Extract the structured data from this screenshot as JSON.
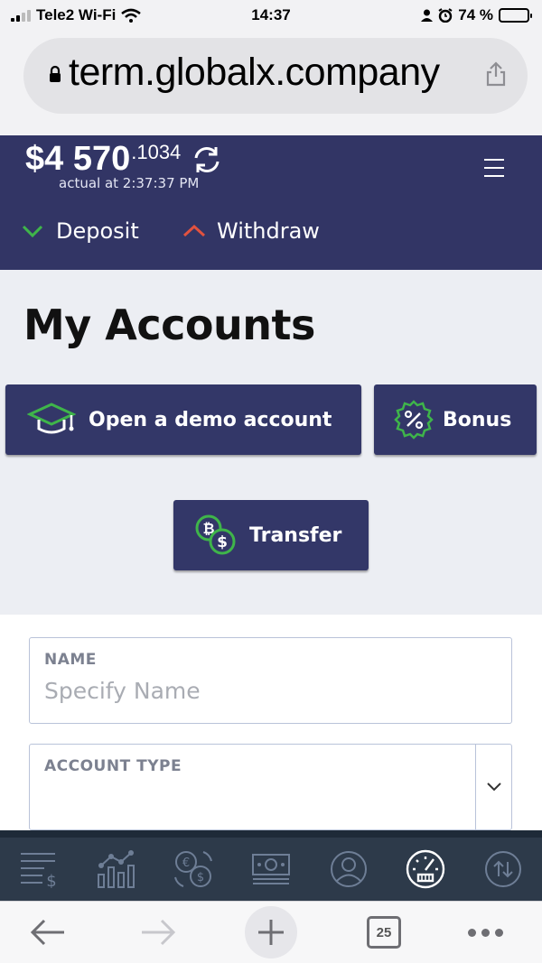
{
  "status": {
    "carrier": "Tele2 Wi-Fi",
    "time": "14:37",
    "battery": "74 %",
    "battery_level": 0.74
  },
  "browser": {
    "url": "term.globalx.company",
    "tab_count": "25"
  },
  "header": {
    "balance_main": "$4 570",
    "balance_fraction": ".1034",
    "actual_at": "actual at 2:37:37 PM",
    "deposit_label": "Deposit",
    "withdraw_label": "Withdraw"
  },
  "page": {
    "title": "My Accounts",
    "demo_button": "Open a demo account",
    "bonus_button": "Bonus",
    "transfer_button": "Transfer"
  },
  "form": {
    "name_label": "NAME",
    "name_placeholder": "Specify Name",
    "name_value": "",
    "account_type_label": "ACCOUNT TYPE",
    "account_type_value": ""
  },
  "colors": {
    "header_bg": "#323565",
    "button_bg": "#333768",
    "accent_green": "#3fb54a",
    "accent_red": "#e2523f",
    "content_bg": "#eceef3",
    "nav_bg": "#2d3a4a"
  },
  "bottom_nav": [
    "orders-icon",
    "chart-icon",
    "exchange-icon",
    "money-icon",
    "profile-icon",
    "dashboard-icon",
    "transfer-arrows-icon"
  ]
}
